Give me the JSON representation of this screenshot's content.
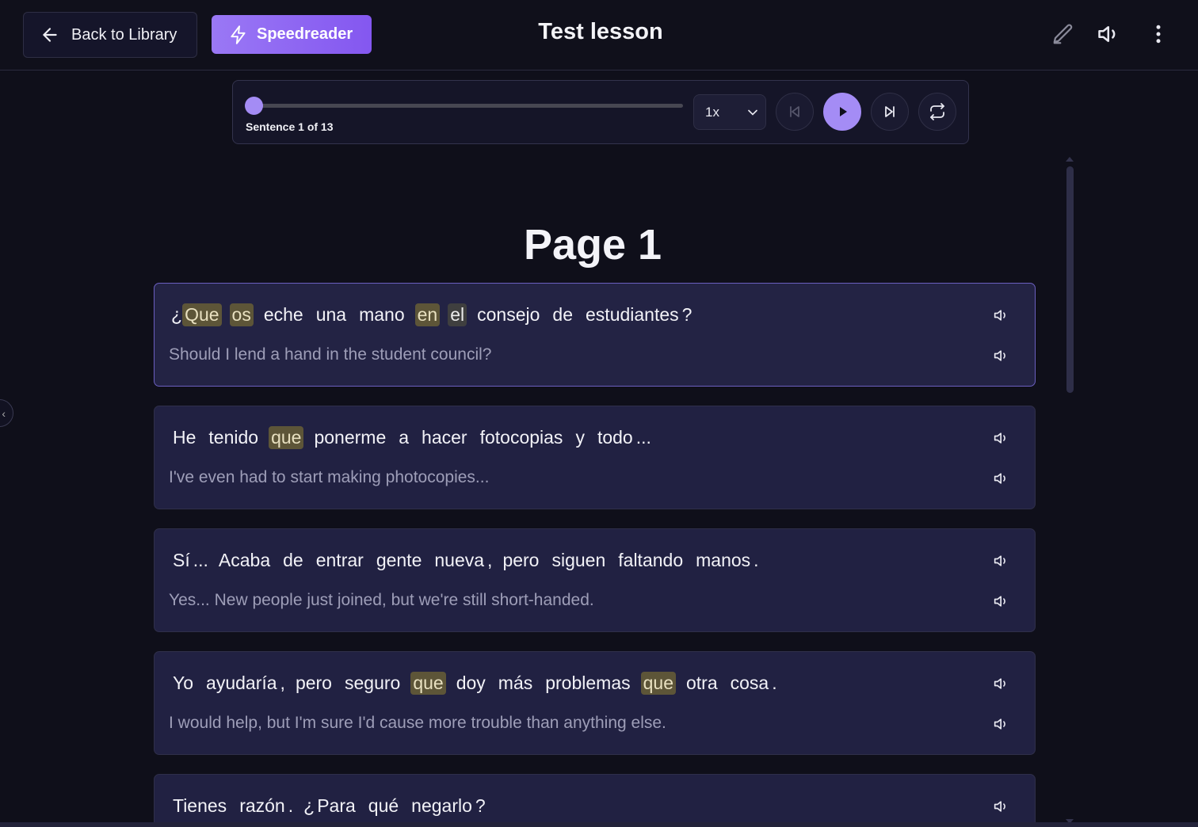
{
  "header": {
    "back_label": "Back to Library",
    "speedreader_label": "Speedreader",
    "title": "Test lesson",
    "icons": [
      "edit-icon",
      "volume-icon",
      "more-vertical-icon"
    ]
  },
  "player": {
    "progress": 0,
    "sentence_label": "Sentence 1 of 13",
    "speed": "1x",
    "buttons": [
      "skip-back-icon",
      "play-icon",
      "skip-forward-icon",
      "repeat-icon"
    ]
  },
  "page": {
    "heading": "Page 1"
  },
  "sentences": [
    {
      "words": [
        {
          "t": "¿",
          "c": "pre"
        },
        {
          "t": "Que",
          "c": "hl"
        },
        {
          "t": "os",
          "c": "hl"
        },
        {
          "t": "eche"
        },
        {
          "t": "una"
        },
        {
          "t": "mano"
        },
        {
          "t": "en",
          "c": "hl"
        },
        {
          "t": "el",
          "c": "hl2"
        },
        {
          "t": "consejo"
        },
        {
          "t": "de"
        },
        {
          "t": "estudiantes"
        },
        {
          "t": "?",
          "c": "punct"
        }
      ],
      "translation": "Should I lend a hand in the student council?",
      "active": true
    },
    {
      "words": [
        {
          "t": "He"
        },
        {
          "t": "tenido"
        },
        {
          "t": "que",
          "c": "hl"
        },
        {
          "t": "ponerme"
        },
        {
          "t": "a"
        },
        {
          "t": "hacer"
        },
        {
          "t": "fotocopias"
        },
        {
          "t": "y"
        },
        {
          "t": "todo"
        },
        {
          "t": "...",
          "c": "punct"
        }
      ],
      "translation": "I've even had to start making photocopies..."
    },
    {
      "words": [
        {
          "t": "Sí"
        },
        {
          "t": "...",
          "c": "punct"
        },
        {
          "t": "Acaba"
        },
        {
          "t": "de"
        },
        {
          "t": "entrar"
        },
        {
          "t": "gente"
        },
        {
          "t": "nueva"
        },
        {
          "t": ",",
          "c": "punct"
        },
        {
          "t": "pero"
        },
        {
          "t": "siguen"
        },
        {
          "t": "faltando"
        },
        {
          "t": "manos"
        },
        {
          "t": ".",
          "c": "punct"
        }
      ],
      "translation": "Yes... New people just joined, but we're still short-handed."
    },
    {
      "words": [
        {
          "t": "Yo"
        },
        {
          "t": "ayudaría"
        },
        {
          "t": ",",
          "c": "punct"
        },
        {
          "t": "pero"
        },
        {
          "t": "seguro"
        },
        {
          "t": "que",
          "c": "hl"
        },
        {
          "t": "doy"
        },
        {
          "t": "más"
        },
        {
          "t": "problemas"
        },
        {
          "t": "que",
          "c": "hl"
        },
        {
          "t": "otra"
        },
        {
          "t": "cosa"
        },
        {
          "t": ".",
          "c": "punct"
        }
      ],
      "translation": "I would help, but I'm sure I'd cause more trouble than anything else."
    },
    {
      "words": [
        {
          "t": "Tienes"
        },
        {
          "t": "razón"
        },
        {
          "t": ".",
          "c": "punct"
        },
        {
          "t": "¿",
          "c": "pre"
        },
        {
          "t": "Para"
        },
        {
          "t": "qué"
        },
        {
          "t": "negarlo"
        },
        {
          "t": "?",
          "c": "punct"
        }
      ],
      "translation": ""
    }
  ],
  "colors": {
    "accent": "#a48cf5",
    "highlight": "#5d5538",
    "card_bg": "#212142"
  }
}
